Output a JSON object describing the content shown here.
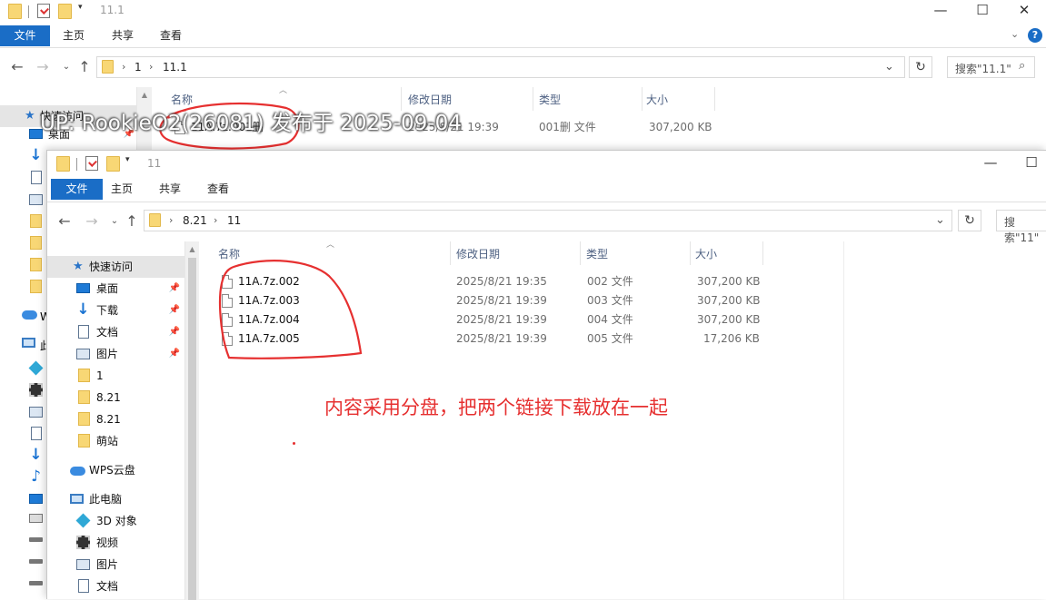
{
  "back_window": {
    "title": "11.1",
    "ribbon_tabs": {
      "file": "文件",
      "home": "主页",
      "share": "共享",
      "view": "查看"
    },
    "breadcrumb": [
      "1",
      "11.1"
    ],
    "search_placeholder": "搜索\"11.1\"",
    "nav_labels": {
      "quick_access": "快速访问",
      "desktop": "桌面",
      "wps_cloud_partial": "W",
      "this_pc_partial": "此"
    },
    "columns": {
      "name": "名称",
      "modified": "修改日期",
      "type": "类型",
      "size": "大小"
    },
    "files": [
      {
        "name": "11A.7z.001删",
        "modified": "2025/8/21 19:39",
        "type": "001删 文件",
        "size": "307,200 KB"
      }
    ]
  },
  "front_window": {
    "title": "11",
    "ribbon_tabs": {
      "file": "文件",
      "home": "主页",
      "share": "共享",
      "view": "查看"
    },
    "breadcrumb": [
      "8.21",
      "11"
    ],
    "search_placeholder": "搜索\"11\"",
    "nav": {
      "quick_access": "快速访问",
      "desktop": "桌面",
      "downloads": "下载",
      "documents": "文档",
      "pictures": "图片",
      "folder_1": "1",
      "folder_821a": "8.21",
      "folder_821b": "8.21",
      "folder_mengzhan": "萌站",
      "wps_cloud": "WPS云盘",
      "this_pc": "此电脑",
      "objects_3d": "3D 对象",
      "videos": "视频",
      "pc_pictures": "图片",
      "pc_documents": "文档"
    },
    "columns": {
      "name": "名称",
      "modified": "修改日期",
      "type": "类型",
      "size": "大小"
    },
    "files": [
      {
        "name": "11A.7z.002",
        "modified": "2025/8/21 19:35",
        "type": "002 文件",
        "size": "307,200 KB"
      },
      {
        "name": "11A.7z.003",
        "modified": "2025/8/21 19:39",
        "type": "003 文件",
        "size": "307,200 KB"
      },
      {
        "name": "11A.7z.004",
        "modified": "2025/8/21 19:39",
        "type": "004 文件",
        "size": "307,200 KB"
      },
      {
        "name": "11A.7z.005",
        "modified": "2025/8/21 19:39",
        "type": "005 文件",
        "size": "17,206 KB"
      }
    ]
  },
  "overlay_text": "UP: RookieO2(26081) 发布于 2025-09-04",
  "annotation_text": "内容采用分盘，把两个链接下载放在一起",
  "colors": {
    "ribbon_blue": "#1a6dc6",
    "annotation_red": "#e63030"
  }
}
